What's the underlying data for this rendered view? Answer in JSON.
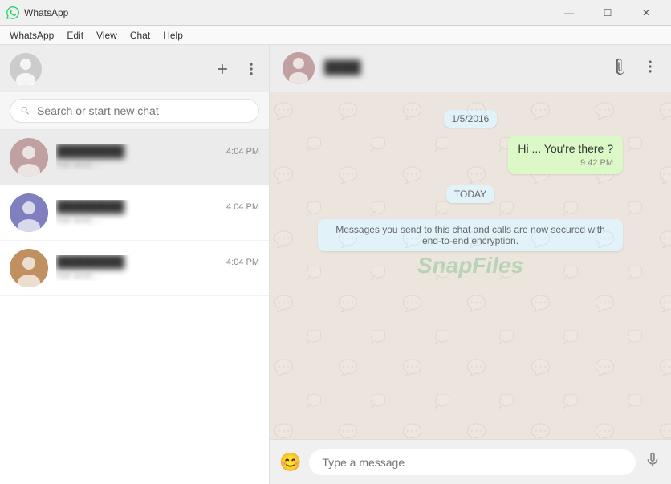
{
  "titlebar": {
    "icon": "whatsapp",
    "title": "WhatsApp",
    "min_btn": "—",
    "max_btn": "☐",
    "close_btn": "✕"
  },
  "menubar": {
    "items": [
      "WhatsApp",
      "Edit",
      "View",
      "Chat",
      "Help"
    ]
  },
  "left_header": {
    "new_chat_label": "+",
    "more_label": "···"
  },
  "search": {
    "placeholder": "Search or start new chat"
  },
  "chat_list": {
    "items": [
      {
        "name": "████████",
        "time": "4:04 PM",
        "preview": "hat and..."
      },
      {
        "name": "████████",
        "time": "4:04 PM",
        "preview": "hat and..."
      },
      {
        "name": "████████",
        "time": "4:04 PM",
        "preview": "hat and..."
      }
    ]
  },
  "chat_header": {
    "contact_name": "████",
    "paperclip_label": "📎",
    "more_label": "···"
  },
  "messages": {
    "date_badge_old": "1/5/2016",
    "message1": {
      "text": "Hi ... You're there ?",
      "time": "9:42 PM"
    },
    "date_badge_today": "TODAY",
    "system_msg": "Messages you send to this chat and calls are now secured with end-to-end encryption."
  },
  "input_bar": {
    "placeholder": "Type a message",
    "emoji": "😊",
    "mic": "🎤"
  },
  "watermark": "SnapFiles"
}
